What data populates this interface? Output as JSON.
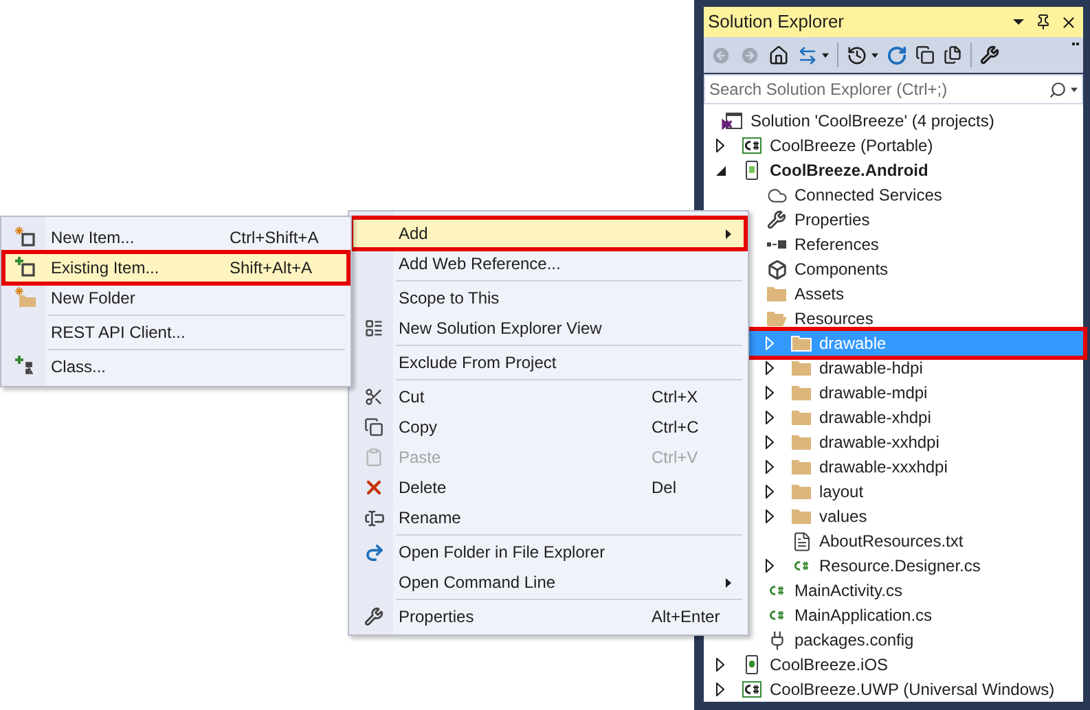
{
  "solution_explorer": {
    "title": "Solution Explorer",
    "search": {
      "placeholder": "Search Solution Explorer (Ctrl+;)"
    },
    "tree": [
      {
        "label": "Solution 'CoolBreeze' (4 projects)",
        "kind": "solution",
        "selected": false,
        "outlined": false,
        "children": [
          {
            "label": "CoolBreeze (Portable)",
            "kind": "cs-project",
            "startup": false,
            "selected": false,
            "outlined": false,
            "expanded": false
          },
          {
            "label": "CoolBreeze.Android",
            "kind": "android-project",
            "startup": true,
            "selected": false,
            "outlined": false,
            "expanded": true,
            "children": [
              {
                "label": "Connected Services",
                "kind": "service",
                "selected": false,
                "outlined": false
              },
              {
                "label": "Properties",
                "kind": "properties",
                "selected": false,
                "outlined": false
              },
              {
                "label": "References",
                "kind": "references",
                "selected": false,
                "outlined": false
              },
              {
                "label": "Components",
                "kind": "components",
                "selected": false,
                "outlined": false
              },
              {
                "label": "Assets",
                "kind": "folder",
                "selected": false,
                "outlined": false
              },
              {
                "label": "Resources",
                "kind": "folder-open",
                "selected": false,
                "outlined": false,
                "children": [
                  {
                    "label": "drawable",
                    "kind": "folder",
                    "selected": true,
                    "outlined": true,
                    "expanded": false
                  },
                  {
                    "label": "drawable-hdpi",
                    "kind": "folder",
                    "selected": false,
                    "outlined": false,
                    "expanded": false
                  },
                  {
                    "label": "drawable-mdpi",
                    "kind": "folder",
                    "selected": false,
                    "outlined": false,
                    "expanded": false
                  },
                  {
                    "label": "drawable-xhdpi",
                    "kind": "folder",
                    "selected": false,
                    "outlined": false,
                    "expanded": false
                  },
                  {
                    "label": "drawable-xxhdpi",
                    "kind": "folder",
                    "selected": false,
                    "outlined": false,
                    "expanded": false
                  },
                  {
                    "label": "drawable-xxxhdpi",
                    "kind": "folder",
                    "selected": false,
                    "outlined": false,
                    "expanded": false
                  },
                  {
                    "label": "layout",
                    "kind": "folder",
                    "selected": false,
                    "outlined": false,
                    "expanded": false
                  },
                  {
                    "label": "values",
                    "kind": "folder",
                    "selected": false,
                    "outlined": false,
                    "expanded": false
                  },
                  {
                    "label": "AboutResources.txt",
                    "kind": "text-file",
                    "selected": false,
                    "outlined": false
                  },
                  {
                    "label": "Resource.Designer.cs",
                    "kind": "cs-file",
                    "selected": false,
                    "outlined": false,
                    "expanded": false
                  }
                ]
              },
              {
                "label": "MainActivity.cs",
                "kind": "cs-file",
                "selected": false,
                "outlined": false
              },
              {
                "label": "MainApplication.cs",
                "kind": "cs-file",
                "selected": false,
                "outlined": false
              },
              {
                "label": "packages.config",
                "kind": "config-file",
                "selected": false,
                "outlined": false
              }
            ]
          },
          {
            "label": "CoolBreeze.iOS",
            "kind": "ios-project",
            "startup": false,
            "selected": false,
            "outlined": false,
            "expanded": false
          },
          {
            "label": "CoolBreeze.UWP (Universal Windows)",
            "kind": "cs-project",
            "startup": false,
            "selected": false,
            "outlined": false,
            "expanded": false
          }
        ]
      }
    ]
  },
  "context_menu": {
    "items": [
      {
        "kind": "item",
        "label": "Add",
        "submenu": true,
        "highlighted": true,
        "outlined": true,
        "disabled": false
      },
      {
        "kind": "item",
        "label": "Add Web Reference...",
        "submenu": false,
        "highlighted": false,
        "outlined": false,
        "disabled": false
      },
      {
        "kind": "separator"
      },
      {
        "kind": "item",
        "label": "Scope to This",
        "submenu": false,
        "highlighted": false,
        "outlined": false,
        "disabled": false
      },
      {
        "kind": "item",
        "label": "New Solution Explorer View",
        "submenu": false,
        "highlighted": false,
        "outlined": false,
        "disabled": false
      },
      {
        "kind": "separator"
      },
      {
        "kind": "item",
        "label": "Exclude From Project",
        "submenu": false,
        "highlighted": false,
        "outlined": false,
        "disabled": false
      },
      {
        "kind": "separator"
      },
      {
        "kind": "item",
        "label": "Cut",
        "shortcut": "Ctrl+X",
        "submenu": false,
        "highlighted": false,
        "outlined": false,
        "disabled": false
      },
      {
        "kind": "item",
        "label": "Copy",
        "shortcut": "Ctrl+C",
        "submenu": false,
        "highlighted": false,
        "outlined": false,
        "disabled": false
      },
      {
        "kind": "item",
        "label": "Paste",
        "shortcut": "Ctrl+V",
        "submenu": false,
        "highlighted": false,
        "outlined": false,
        "disabled": true
      },
      {
        "kind": "item",
        "label": "Delete",
        "shortcut": "Del",
        "submenu": false,
        "highlighted": false,
        "outlined": false,
        "disabled": false
      },
      {
        "kind": "item",
        "label": "Rename",
        "submenu": false,
        "highlighted": false,
        "outlined": false,
        "disabled": false
      },
      {
        "kind": "separator"
      },
      {
        "kind": "item",
        "label": "Open Folder in File Explorer",
        "submenu": false,
        "highlighted": false,
        "outlined": false,
        "disabled": false
      },
      {
        "kind": "item",
        "label": "Open Command Line",
        "submenu": true,
        "highlighted": false,
        "outlined": false,
        "disabled": false
      },
      {
        "kind": "separator"
      },
      {
        "kind": "item",
        "label": "Properties",
        "shortcut": "Alt+Enter",
        "submenu": false,
        "highlighted": false,
        "outlined": false,
        "disabled": false
      }
    ]
  },
  "add_submenu": {
    "items": [
      {
        "kind": "item",
        "label": "New Item...",
        "shortcut": "Ctrl+Shift+A",
        "highlighted": false,
        "outlined": false
      },
      {
        "kind": "item",
        "label": "Existing Item...",
        "shortcut": "Shift+Alt+A",
        "highlighted": true,
        "outlined": true
      },
      {
        "kind": "item",
        "label": "New Folder",
        "highlighted": false,
        "outlined": false
      },
      {
        "kind": "separator"
      },
      {
        "kind": "item",
        "label": "REST API Client...",
        "highlighted": false,
        "outlined": false
      },
      {
        "kind": "separator"
      },
      {
        "kind": "item",
        "label": "Class...",
        "highlighted": false,
        "outlined": false
      }
    ]
  }
}
